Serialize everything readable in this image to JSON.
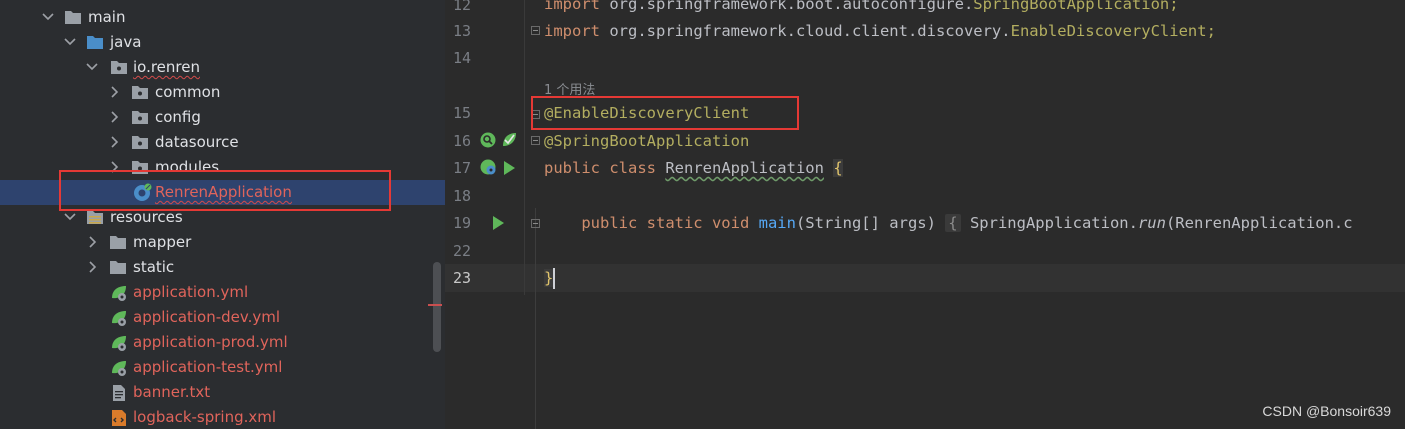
{
  "tree": {
    "items": [
      {
        "label": "main",
        "color": "default"
      },
      {
        "label": "java",
        "color": "default"
      },
      {
        "label": "io.renren",
        "color": "default"
      },
      {
        "label": "common",
        "color": "default"
      },
      {
        "label": "config",
        "color": "default"
      },
      {
        "label": "datasource",
        "color": "default"
      },
      {
        "label": "modules",
        "color": "default"
      },
      {
        "label": "RenrenApplication",
        "color": "red"
      },
      {
        "label": "resources",
        "color": "default"
      },
      {
        "label": "mapper",
        "color": "default"
      },
      {
        "label": "static",
        "color": "default"
      },
      {
        "label": "application.yml",
        "color": "red"
      },
      {
        "label": "application-dev.yml",
        "color": "red"
      },
      {
        "label": "application-prod.yml",
        "color": "red"
      },
      {
        "label": "application-test.yml",
        "color": "red"
      },
      {
        "label": "banner.txt",
        "color": "red"
      },
      {
        "label": "logback-spring.xml",
        "color": "red"
      }
    ]
  },
  "editor": {
    "line_numbers": [
      "12",
      "13",
      "14",
      "15",
      "16",
      "17",
      "18",
      "19",
      "22",
      "23"
    ],
    "usage_hint": "1 个用法",
    "code": {
      "l12_kw": "import",
      "l12_pkg": " org.springframework.boot.autoconfigure.",
      "l12_cls": "SpringBootApplication;",
      "l13_kw": "import",
      "l13_pkg": " org.springframework.cloud.client.discovery.",
      "l13_cls": "EnableDiscoveryClient;",
      "l15_ann": "@EnableDiscoveryClient",
      "l16_ann": "@SpringBootApplication",
      "l17_kw": "public class ",
      "l17_cls": "RenrenApplication",
      "l17_brace": "{",
      "l19_indent": "    ",
      "l19_kw": "public static void ",
      "l19_fn": "main",
      "l19_sig": "(String[] args)",
      "l19_fold": "{",
      "l19_body1": " SpringApplication.",
      "l19_run": "run",
      "l19_body2": "(RenrenApplication.c",
      "l23_brace": "}"
    }
  },
  "watermark": "CSDN @Bonsoir639",
  "colors": {
    "tree_bg": "#2b2d30",
    "editor_bg": "#2b2b2b",
    "selection": "#2e436e",
    "keyword": "#cf8e6d",
    "annotation": "#b3ae60",
    "highlight_box": "#e53935"
  }
}
